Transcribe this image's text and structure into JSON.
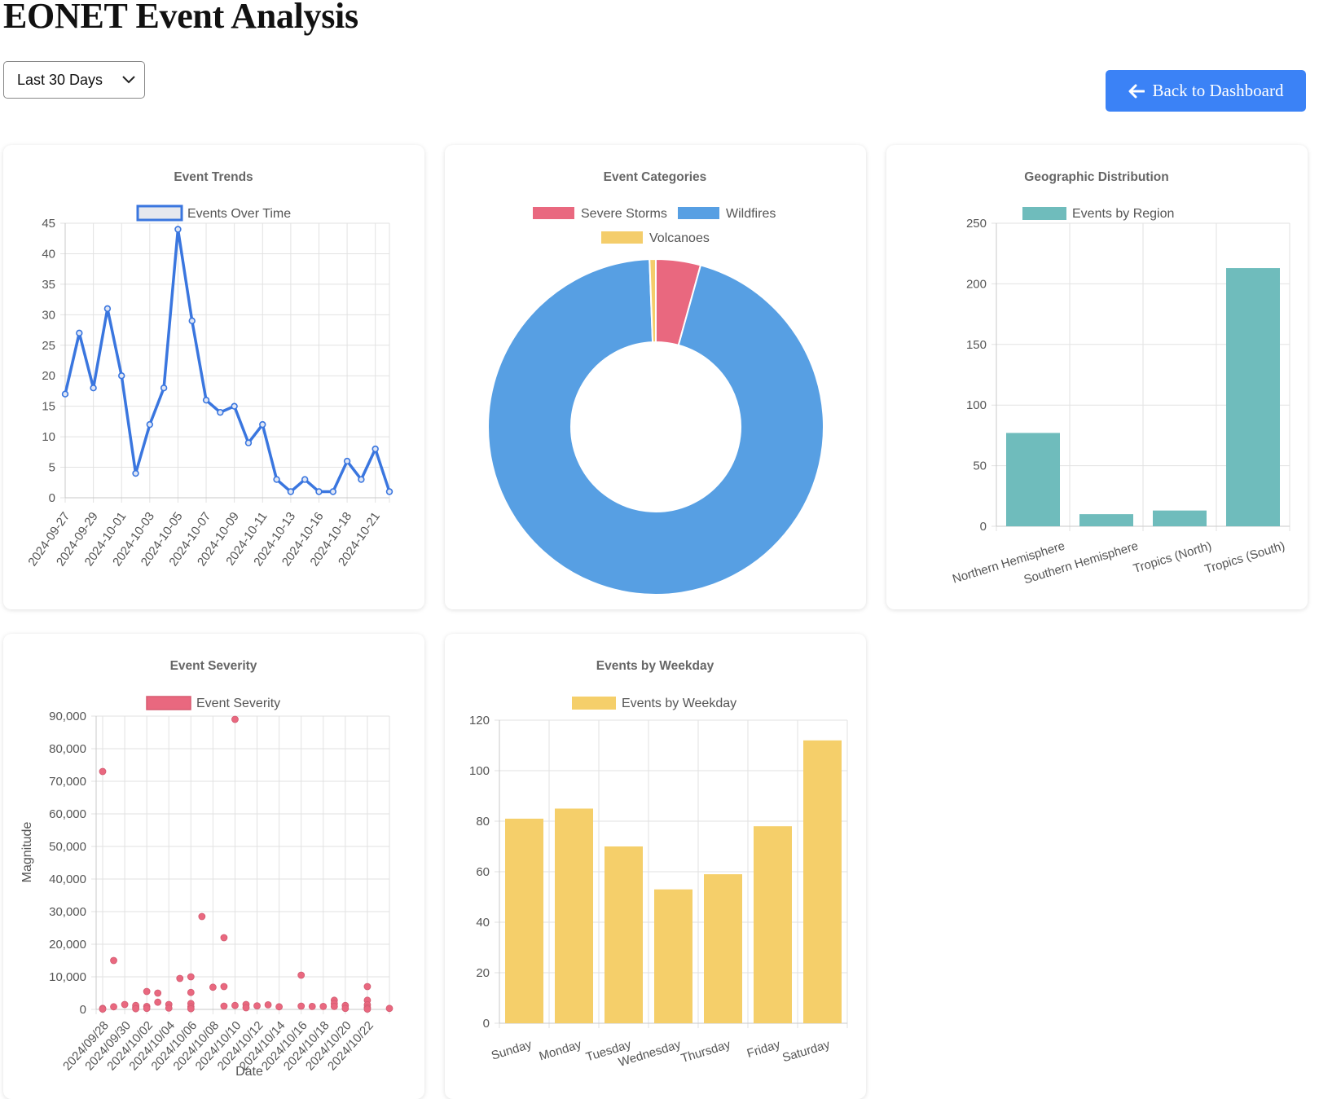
{
  "header": {
    "title": "EONET Event Analysis"
  },
  "controls": {
    "range_select": {
      "selected": "Last 30 Days"
    },
    "back_button": {
      "label": "Back to Dashboard",
      "icon": "arrow-left-icon"
    }
  },
  "colors": {
    "accent": "#3b82f6",
    "line": "#3a76df",
    "storm": "#e9687f",
    "wildfire": "#579fe3",
    "volcano": "#f4cd6b",
    "region": "#6fbcbc",
    "weekday": "#f5cf6a"
  },
  "chart_data": [
    {
      "type": "line",
      "title": "Event Trends",
      "series": [
        {
          "name": "Events Over Time",
          "values": [
            17,
            27,
            18,
            31,
            20,
            4,
            12,
            18,
            44,
            29,
            16,
            14,
            15,
            9,
            12,
            3,
            1,
            3,
            1,
            1,
            6,
            3,
            8,
            1
          ]
        }
      ],
      "x_ticks": [
        "2024-09-27",
        "2024-09-29",
        "2024-10-01",
        "2024-10-03",
        "2024-10-05",
        "2024-10-07",
        "2024-10-09",
        "2024-10-11",
        "2024-10-13",
        "2024-10-16",
        "2024-10-18",
        "2024-10-21"
      ],
      "ylim": [
        0,
        45
      ],
      "y_ticks": [
        "0",
        "5",
        "10",
        "15",
        "20",
        "25",
        "30",
        "35",
        "40",
        "45"
      ],
      "grid": true,
      "legend": "top"
    },
    {
      "type": "pie",
      "title": "Event Categories",
      "categories": [
        "Severe Storms",
        "Wildfires",
        "Volcanoes"
      ],
      "values": [
        4.3,
        95.1,
        0.6
      ],
      "legend": "top"
    },
    {
      "type": "bar",
      "title": "Geographic Distribution",
      "series": [
        {
          "name": "Events by Region",
          "values": [
            77,
            10,
            13,
            213
          ]
        }
      ],
      "categories": [
        "Northern Hemisphere",
        "Southern Hemisphere",
        "Tropics (North)",
        "Tropics (South)"
      ],
      "ylim": [
        0,
        250
      ],
      "y_ticks": [
        "0",
        "50",
        "100",
        "150",
        "200",
        "250"
      ],
      "grid": true,
      "legend": "top"
    },
    {
      "type": "scatter",
      "title": "Event Severity",
      "series": [
        {
          "name": "Event Severity",
          "points": [
            [
              0,
              73000
            ],
            [
              0,
              300
            ],
            [
              0,
              100
            ],
            [
              1,
              15000
            ],
            [
              1,
              800
            ],
            [
              2,
              1500
            ],
            [
              3,
              600
            ],
            [
              3,
              1200
            ],
            [
              3,
              200
            ],
            [
              4,
              5500
            ],
            [
              4,
              900
            ],
            [
              4,
              300
            ],
            [
              5,
              5000
            ],
            [
              5,
              2200
            ],
            [
              6,
              1500
            ],
            [
              6,
              400
            ],
            [
              7,
              9500
            ],
            [
              8,
              10000
            ],
            [
              8,
              5200
            ],
            [
              8,
              1800
            ],
            [
              8,
              800
            ],
            [
              8,
              200
            ],
            [
              9,
              28500
            ],
            [
              10,
              6800
            ],
            [
              11,
              22000
            ],
            [
              11,
              7000
            ],
            [
              11,
              1000
            ],
            [
              12,
              1200
            ],
            [
              12,
              89000
            ],
            [
              13,
              1500
            ],
            [
              13,
              500
            ],
            [
              14,
              1100
            ],
            [
              15,
              1400
            ],
            [
              16,
              800
            ],
            [
              18,
              10500
            ],
            [
              18,
              1000
            ],
            [
              19,
              900
            ],
            [
              20,
              900
            ],
            [
              21,
              2800
            ],
            [
              21,
              1800
            ],
            [
              21,
              900
            ],
            [
              22,
              1200
            ],
            [
              22,
              300
            ],
            [
              24,
              7000
            ],
            [
              24,
              2800
            ],
            [
              24,
              1400
            ],
            [
              24,
              500
            ],
            [
              24,
              100
            ],
            [
              26,
              300
            ]
          ]
        }
      ],
      "x_ticks": [
        "2024/09/28",
        "2024/09/30",
        "2024/10/02",
        "2024/10/04",
        "2024/10/06",
        "2024/10/08",
        "2024/10/10",
        "2024/10/12",
        "2024/10/14",
        "2024/10/16",
        "2024/10/18",
        "2024/10/20",
        "2024/10/22"
      ],
      "xlabel": "Date",
      "ylabel": "Magnitude",
      "ylim": [
        0,
        90000
      ],
      "y_ticks": [
        "0",
        "10,000",
        "20,000",
        "30,000",
        "40,000",
        "50,000",
        "60,000",
        "70,000",
        "80,000",
        "90,000"
      ],
      "grid": true,
      "legend": "top"
    },
    {
      "type": "bar",
      "title": "Events by Weekday",
      "series": [
        {
          "name": "Events by Weekday",
          "values": [
            81,
            85,
            70,
            53,
            59,
            78,
            112
          ]
        }
      ],
      "categories": [
        "Sunday",
        "Monday",
        "Tuesday",
        "Wednesday",
        "Thursday",
        "Friday",
        "Saturday"
      ],
      "ylim": [
        0,
        120
      ],
      "y_ticks": [
        "0",
        "20",
        "40",
        "60",
        "80",
        "100",
        "120"
      ],
      "grid": true,
      "legend": "top"
    }
  ]
}
